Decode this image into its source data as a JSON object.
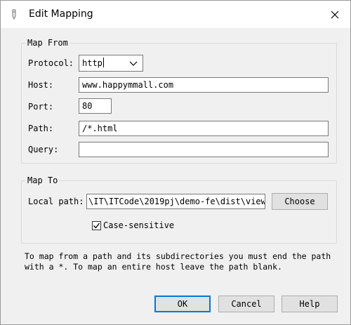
{
  "window": {
    "title": "Edit Mapping",
    "icon": "pen-icon",
    "close_icon": "close-icon"
  },
  "map_from": {
    "group_label": "Map From",
    "protocol": {
      "label": "Protocol:",
      "value": "http",
      "icon": "chevron-down-icon"
    },
    "host": {
      "label": "Host:",
      "value": "www.happymmall.com"
    },
    "port": {
      "label": "Port:",
      "value": "80"
    },
    "path": {
      "label": "Path:",
      "value": "/*.html"
    },
    "query": {
      "label": "Query:",
      "value": ""
    }
  },
  "map_to": {
    "group_label": "Map To",
    "local_path": {
      "label": "Local path:",
      "value": "\\IT\\ITCode\\2019pj\\demo-fe\\dist\\view"
    },
    "choose_label": "Choose",
    "case_sensitive": {
      "label": "Case-sensitive",
      "checked": true
    }
  },
  "note": "To map from a path and its subdirectories you must end the path with a *. To map an entire host leave the path blank.",
  "buttons": {
    "ok": "OK",
    "cancel": "Cancel",
    "help": "Help"
  }
}
